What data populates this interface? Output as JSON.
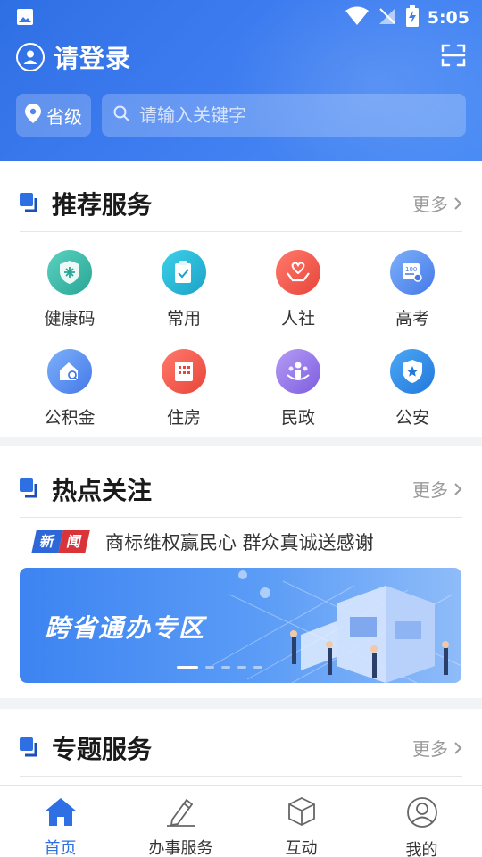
{
  "status_bar": {
    "time": "5:05"
  },
  "header": {
    "login_text": "请登录",
    "location": "省级",
    "search_placeholder": "请输入关键字"
  },
  "recommended": {
    "title": "推荐服务",
    "more": "更多",
    "items": [
      {
        "label": "健康码",
        "icon": "health-code-icon",
        "color": "#36b8a6"
      },
      {
        "label": "常用",
        "icon": "clipboard-icon",
        "color": "#20b5d5"
      },
      {
        "label": "人社",
        "icon": "hands-heart-icon",
        "color": "#f0554a"
      },
      {
        "label": "高考",
        "icon": "exam-icon",
        "color": "#4f8df0"
      },
      {
        "label": "公积金",
        "icon": "house-search-icon",
        "color": "#4f8df0"
      },
      {
        "label": "住房",
        "icon": "building-icon",
        "color": "#f0554a"
      },
      {
        "label": "民政",
        "icon": "people-icon",
        "color": "#8d6ee8"
      },
      {
        "label": "公安",
        "icon": "police-badge-icon",
        "color": "#3a8de8"
      }
    ]
  },
  "hot": {
    "title": "热点关注",
    "more": "更多",
    "news_tag": [
      "新",
      "闻"
    ],
    "news_text": "商标维权赢民心 群众真诚送感谢",
    "banner_text": "跨省通办专区"
  },
  "special": {
    "title": "专题服务",
    "more": "更多"
  },
  "bottom_nav": {
    "items": [
      {
        "label": "首页",
        "icon": "home-icon",
        "active": true
      },
      {
        "label": "办事服务",
        "icon": "pen-icon",
        "active": false
      },
      {
        "label": "互动",
        "icon": "cube-icon",
        "active": false
      },
      {
        "label": "我的",
        "icon": "user-icon",
        "active": false
      }
    ]
  },
  "colors": {
    "primary": "#2f6fe4",
    "news_blue": "#2e68d8",
    "news_red": "#d9343a"
  }
}
